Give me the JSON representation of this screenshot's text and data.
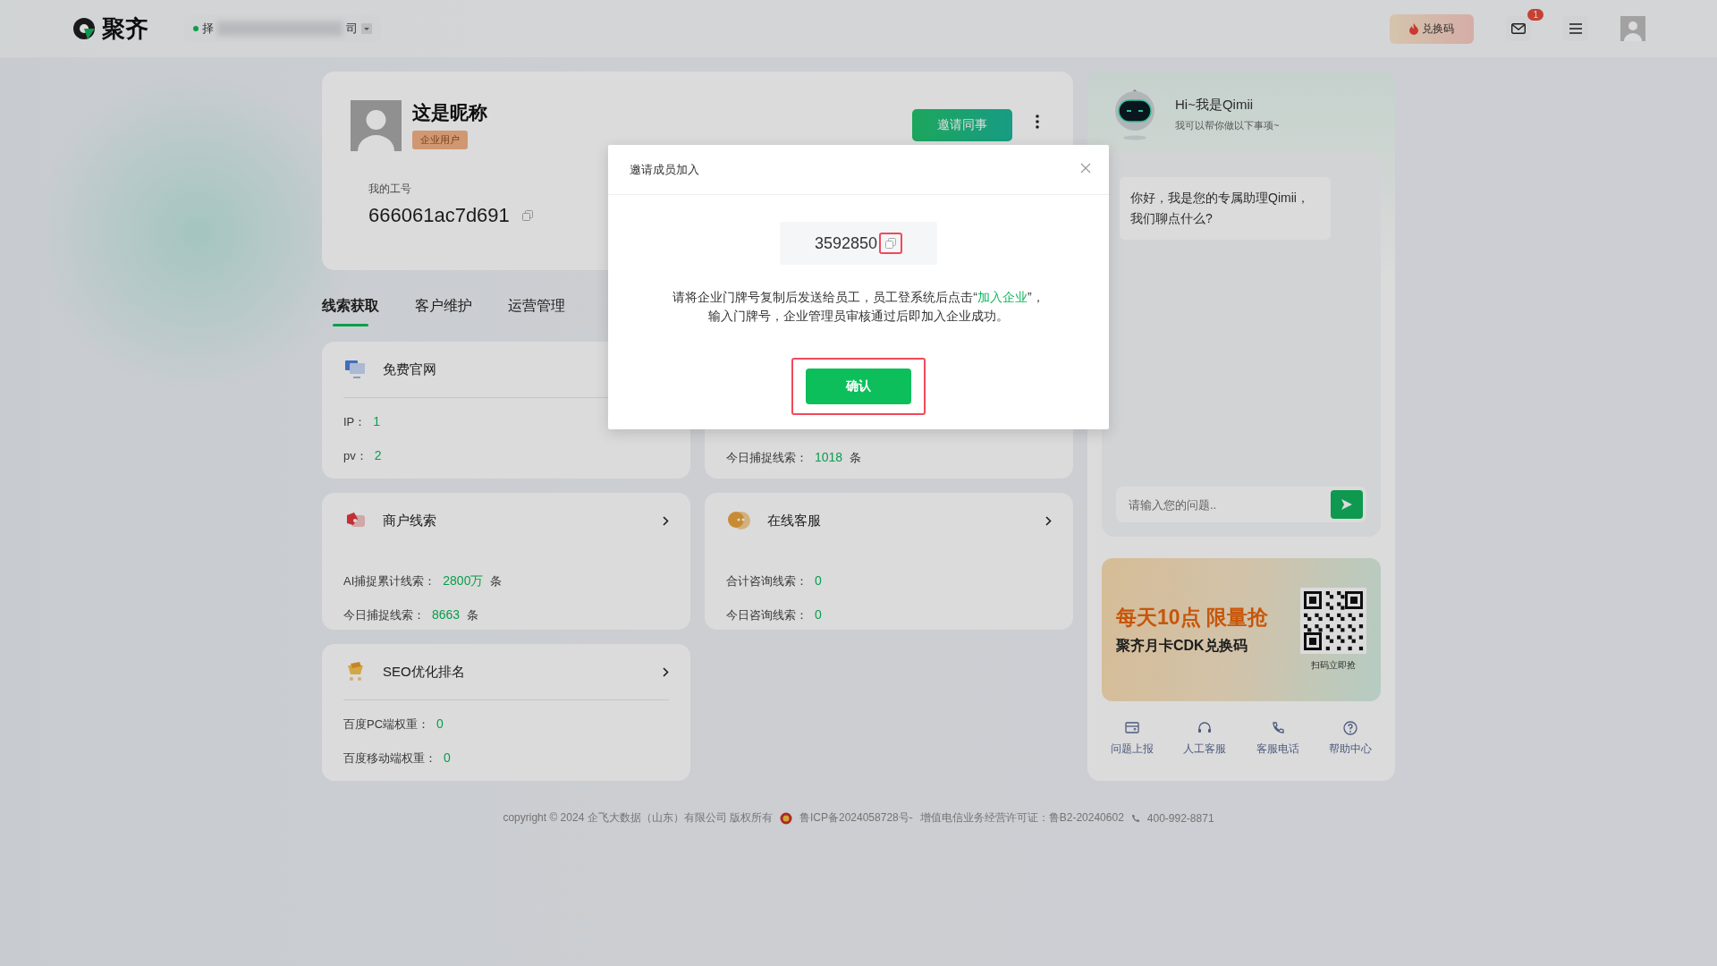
{
  "header": {
    "logo_text": "聚齐",
    "company_start": "择",
    "company_end": "司",
    "redeem_button": "兑换码",
    "mail_badge": "1"
  },
  "profile": {
    "nickname": "这是昵称",
    "badge": "企业用户",
    "id_label": "我的工号",
    "id_value": "666061ac7d691",
    "invite_button": "邀请同事"
  },
  "tabs": [
    {
      "label": "线索获取",
      "selected": true
    },
    {
      "label": "客户维护",
      "selected": false
    },
    {
      "label": "运营管理",
      "selected": false
    }
  ],
  "cards": [
    {
      "title": "免费官网",
      "kind": "monitor",
      "arrow": false,
      "divider": true,
      "rows": [
        {
          "label": "IP：",
          "value": "1"
        },
        {
          "label": "pv：",
          "value": "2"
        }
      ]
    },
    {
      "rows": [
        {
          "label": "今日捕捉线索：",
          "value": "1018",
          "unit": "条"
        }
      ]
    },
    {
      "title": "商户线索",
      "kind": "shop",
      "arrow": true,
      "divider": false,
      "rows": [
        {
          "label": "AI捕捉累计线索：",
          "value": "2800万",
          "unit": "条"
        },
        {
          "label": "今日捕捉线索：",
          "value": "8663",
          "unit": "条"
        }
      ]
    },
    {
      "title": "在线客服",
      "kind": "chat",
      "arrow": true,
      "divider": false,
      "rows": [
        {
          "label": "合计咨询线索：",
          "value": "0"
        },
        {
          "label": "今日咨询线索：",
          "value": "0"
        }
      ]
    },
    {
      "title": "SEO优化排名",
      "kind": "cart",
      "arrow": true,
      "divider": true,
      "rows": [
        {
          "label": "百度PC端权重：",
          "value": "0"
        },
        {
          "label": "百度移动端权重：",
          "value": "0"
        }
      ]
    }
  ],
  "assistant": {
    "greeting": "Hi~我是Qimii",
    "subtitle": "我可以帮你做以下事项~",
    "message": "你好，我是您的专属助理Qimii，我们聊点什么?",
    "input_placeholder": "请输入您的问题.."
  },
  "promo": {
    "headline": "每天10点 限量抢",
    "subline": "聚齐月卡CDK兑换码",
    "qr_caption": "扫码立即抢"
  },
  "quick_links": [
    {
      "label": "问题上报",
      "kind": "report"
    },
    {
      "label": "人工客服",
      "kind": "headset"
    },
    {
      "label": "客服电话",
      "kind": "phone"
    },
    {
      "label": "帮助中心",
      "kind": "help"
    }
  ],
  "footer": {
    "copyright": "copyright © 2024 企飞大数据（山东）有限公司 版权所有",
    "icp": "鲁ICP备2024058728号-",
    "license": "增值电信业务经营许可证：鲁B2-20240602",
    "phone": "400-992-8871"
  },
  "dialog": {
    "title": "邀请成员加入",
    "code": "3592850",
    "instruction": "请将企业门牌号复制后发送给员工，员工登系统后点击“**加入企业**”，输入门牌号，企业管理员审核通过后即加入企业成功。",
    "confirm_button": "确认"
  }
}
